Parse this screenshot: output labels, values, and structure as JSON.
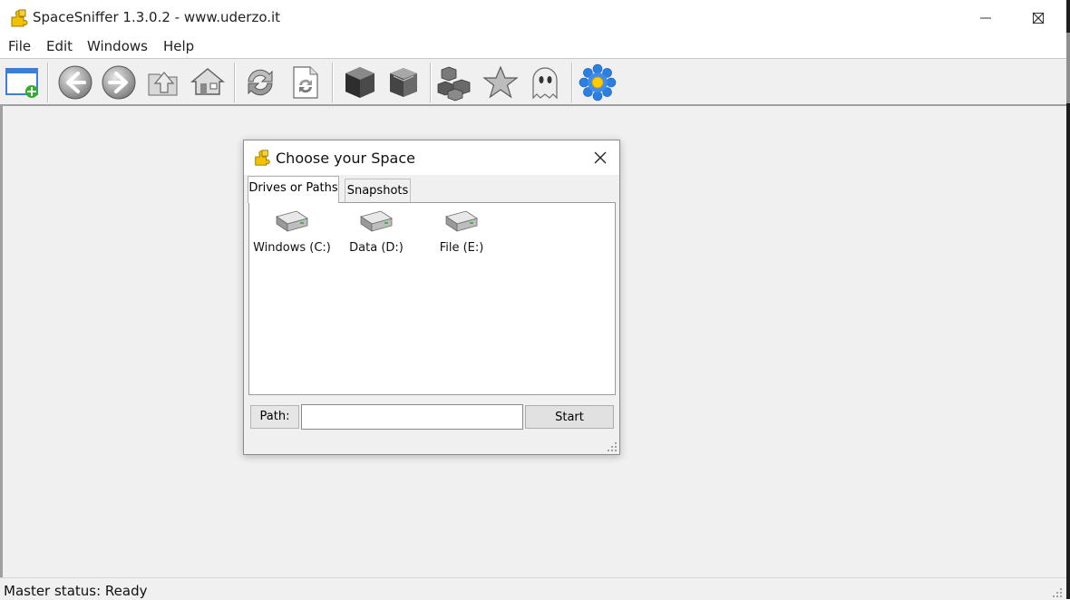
{
  "window": {
    "title": "SpaceSniffer 1.3.0.2 - www.uderzo.it",
    "icon": "puzzle-icon"
  },
  "menu": [
    "File",
    "Edit",
    "Windows",
    "Help"
  ],
  "toolbar": [
    {
      "icon": "new-window-icon"
    },
    {
      "icon": "back-icon"
    },
    {
      "icon": "forward-icon"
    },
    {
      "icon": "up-folder-icon"
    },
    {
      "icon": "home-icon"
    },
    {
      "icon": "refresh-icon"
    },
    {
      "icon": "refresh-document-icon"
    },
    {
      "icon": "box-icon"
    },
    {
      "icon": "box-alt-icon"
    },
    {
      "icon": "cubes-icon"
    },
    {
      "icon": "star-icon"
    },
    {
      "icon": "ghost-icon"
    },
    {
      "icon": "settings-flower-icon"
    }
  ],
  "status": {
    "text": "Master status: Ready"
  },
  "dialog": {
    "title": "Choose your Space",
    "tabs": [
      {
        "label": "Drives or Paths",
        "active": true
      },
      {
        "label": "Snapshots",
        "active": false
      }
    ],
    "drives": [
      {
        "label": "Windows (C:)",
        "icon": "hard-drive-icon"
      },
      {
        "label": "Data (D:)",
        "icon": "hard-drive-icon"
      },
      {
        "label": "File (E:)",
        "icon": "hard-drive-icon"
      }
    ],
    "path_label": "Path:",
    "path_value": "",
    "start_label": "Start"
  }
}
